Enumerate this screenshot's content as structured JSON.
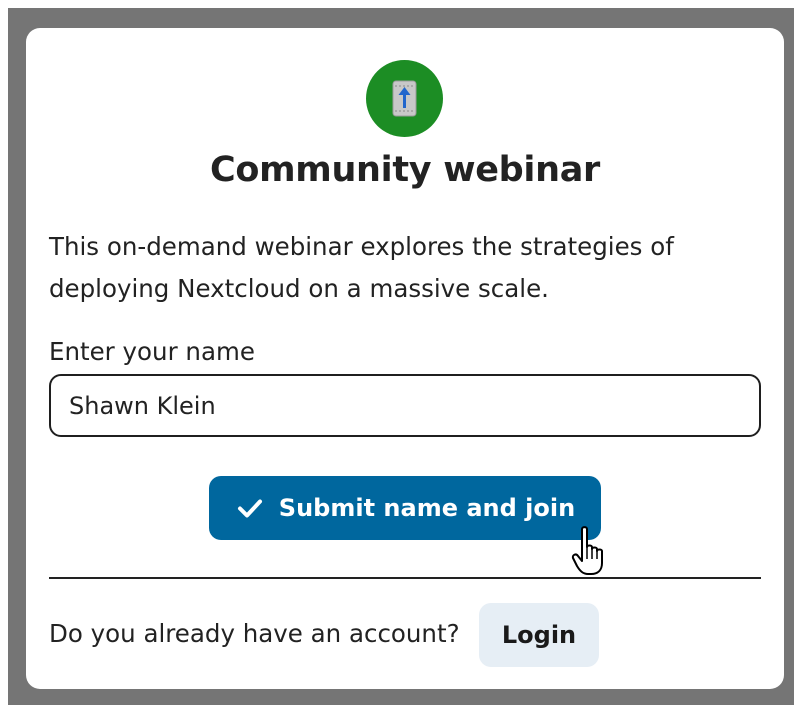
{
  "dialog": {
    "avatar_icon": "room-icon",
    "avatar_color": "#1c8d24",
    "title": "Community webinar",
    "description": "This on-demand webinar explores the strategies of deploying Nextcloud on a massive scale."
  },
  "form": {
    "name_label": "Enter your name",
    "name_value": "Shawn Klein",
    "submit_label": "Submit name and join",
    "submit_icon": "check-icon",
    "submit_color": "#00679e"
  },
  "footer": {
    "account_prompt": "Do you already have an account?",
    "login_label": "Login"
  },
  "cursor": "hand-pointer-icon"
}
